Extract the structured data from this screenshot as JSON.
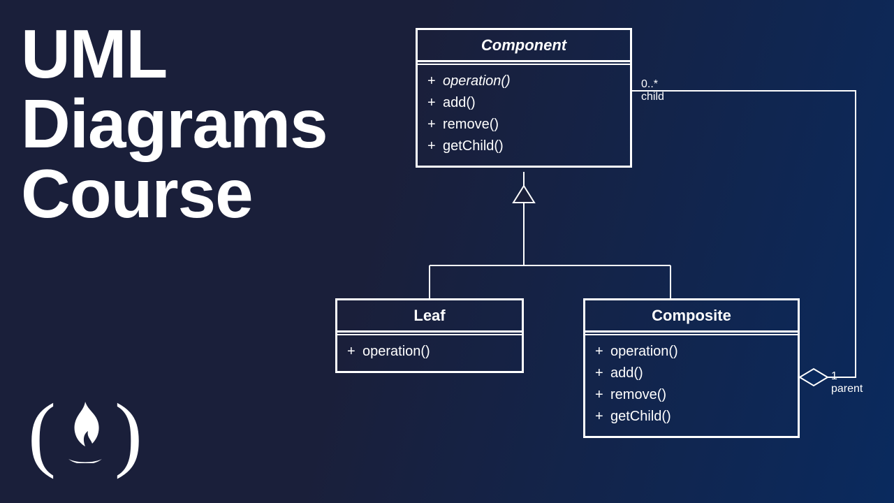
{
  "title": {
    "line1": "UML",
    "line2": "Diagrams",
    "line3": "Course"
  },
  "classes": {
    "component": {
      "name": "Component",
      "ops": [
        {
          "vis": "+",
          "sig": "operation()",
          "abstract": true
        },
        {
          "vis": "+",
          "sig": "add()"
        },
        {
          "vis": "+",
          "sig": "remove()"
        },
        {
          "vis": "+",
          "sig": "getChild()"
        }
      ]
    },
    "leaf": {
      "name": "Leaf",
      "ops": [
        {
          "vis": "+",
          "sig": "operation()"
        }
      ]
    },
    "composite": {
      "name": "Composite",
      "ops": [
        {
          "vis": "+",
          "sig": "operation()"
        },
        {
          "vis": "+",
          "sig": "add()"
        },
        {
          "vis": "+",
          "sig": "remove()"
        },
        {
          "vis": "+",
          "sig": "getChild()"
        }
      ]
    }
  },
  "relations": {
    "generalization": {
      "parent": "Component",
      "children": [
        "Leaf",
        "Composite"
      ]
    },
    "aggregation": {
      "whole": "Composite",
      "part": "Component",
      "whole_end": {
        "mult": "1",
        "role": "parent"
      },
      "part_end": {
        "mult": "0..*",
        "role": "child"
      }
    }
  },
  "logo": {
    "name": "freeCodeCamp"
  }
}
